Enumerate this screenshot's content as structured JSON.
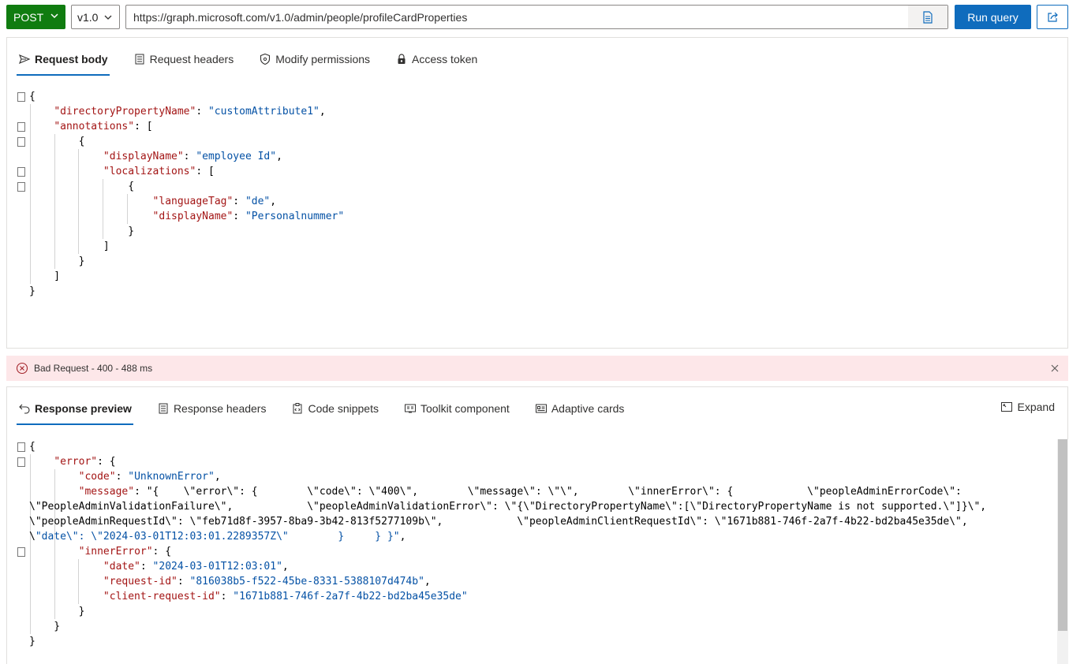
{
  "toolbar": {
    "method": "POST",
    "version": "v1.0",
    "url": "https://graph.microsoft.com/v1.0/admin/people/profileCardProperties",
    "run_label": "Run query"
  },
  "request_tabs": [
    {
      "label": "Request body"
    },
    {
      "label": "Request headers"
    },
    {
      "label": "Modify permissions"
    },
    {
      "label": "Access token"
    }
  ],
  "request_body": [
    "{",
    "    \"directoryPropertyName\": \"customAttribute1\",",
    "    \"annotations\": [",
    "        {",
    "            \"displayName\": \"employee Id\",",
    "            \"localizations\": [",
    "                {",
    "                    \"languageTag\": \"de\",",
    "                    \"displayName\": \"Personalnummer\"",
    "                }",
    "            ]",
    "        }",
    "    ]",
    "}"
  ],
  "status": {
    "text": "Bad Request - 400 - 488 ms",
    "color": "#fde7e9"
  },
  "response_tabs": [
    {
      "label": "Response preview"
    },
    {
      "label": "Response headers"
    },
    {
      "label": "Code snippets"
    },
    {
      "label": "Toolkit component"
    },
    {
      "label": "Adaptive cards"
    }
  ],
  "expand_label": "Expand",
  "response_body": [
    "{",
    "    \"error\": {",
    "        \"code\": \"UnknownError\",",
    "        \"message\": \"{    \\\"error\\\": {        \\\"code\\\": \\\"400\\\",        \\\"message\\\": \\\"\\\",        \\\"innerError\\\": {            \\\"peopleAdminErrorCode\\\":",
    "\\\"PeopleAdminValidationFailure\\\",            \\\"peopleAdminValidationError\\\": \\\"{\\\"DirectoryPropertyName\\\":[\\\"DirectoryPropertyName is not supported.\\\"]}\\\",",
    "\\\"peopleAdminRequestId\\\": \\\"feb71d8f-3957-8ba9-3b42-813f5277109b\\\",            \\\"peopleAdminClientRequestId\\\": \\\"1671b881-746f-2a7f-4b22-bd2ba45e35de\\\",",
    "\\\"date\\\": \\\"2024-03-01T12:03:01.2289357Z\\\"        }     } }\",",
    "        \"innerError\": {",
    "            \"date\": \"2024-03-01T12:03:01\",",
    "            \"request-id\": \"816038b5-f522-45be-8331-5388107d474b\",",
    "            \"client-request-id\": \"1671b881-746f-2a7f-4b22-bd2ba45e35de\"",
    "        }",
    "    }",
    "}"
  ],
  "colors": {
    "method": "#107c10",
    "accent": "#0f6cbd",
    "json_key": "#a31515",
    "json_string": "#0451a5"
  }
}
